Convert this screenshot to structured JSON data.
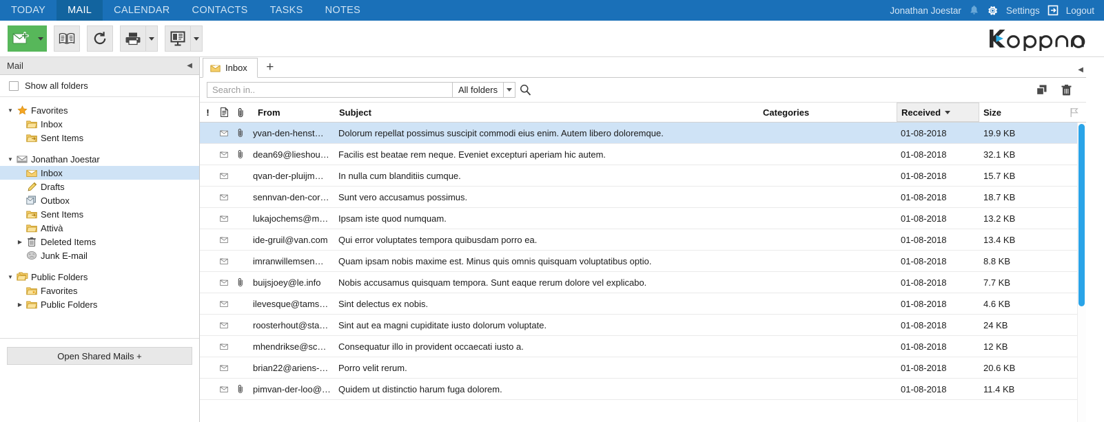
{
  "topnav": {
    "tabs": [
      {
        "label": "TODAY",
        "active": false
      },
      {
        "label": "MAIL",
        "active": true
      },
      {
        "label": "CALENDAR",
        "active": false
      },
      {
        "label": "CONTACTS",
        "active": false
      },
      {
        "label": "TASKS",
        "active": false
      },
      {
        "label": "NOTES",
        "active": false
      }
    ],
    "username": "Jonathan Joestar",
    "settings_label": "Settings",
    "logout_label": "Logout",
    "bell_icon": "bell-icon",
    "gear_icon": "gear-icon",
    "logout_icon": "logout-icon",
    "accent_color": "#1a70b8",
    "active_tab_color": "#12649f"
  },
  "toolbar": {
    "new_mail": {
      "icon": "new-mail-icon",
      "color": "#57b75a"
    },
    "address_book": {
      "icon": "address-book-icon"
    },
    "refresh": {
      "icon": "refresh-icon"
    },
    "print": {
      "icon": "print-icon"
    },
    "view": {
      "icon": "view-layout-icon"
    }
  },
  "logo": {
    "k": "K",
    "rest": "opano",
    "accent": "#29abe2"
  },
  "sidebar": {
    "header_title": "Mail",
    "collapse_icon": "collapse-left-icon",
    "show_all_label": "Show all folders",
    "show_all_checked": false,
    "tree": [
      {
        "label": "Favorites",
        "icon": "star-icon",
        "level": 0,
        "twisty": "down",
        "selected": false
      },
      {
        "label": "Inbox",
        "icon": "folder-open-icon",
        "level": 1,
        "twisty": "",
        "selected": false
      },
      {
        "label": "Sent Items",
        "icon": "folder-sent-icon",
        "level": 1,
        "twisty": "",
        "selected": false
      },
      {
        "label": "",
        "icon": "",
        "level": 0,
        "twisty": "",
        "selected": false,
        "spacer": true
      },
      {
        "label": "Jonathan Joestar",
        "icon": "mailbox-icon",
        "level": 0,
        "twisty": "down",
        "selected": false
      },
      {
        "label": "Inbox",
        "icon": "inbox-folder-icon",
        "level": 1,
        "twisty": "",
        "selected": true
      },
      {
        "label": "Drafts",
        "icon": "pencil-icon",
        "level": 1,
        "twisty": "",
        "selected": false
      },
      {
        "label": "Outbox",
        "icon": "outbox-icon",
        "level": 1,
        "twisty": "",
        "selected": false
      },
      {
        "label": "Sent Items",
        "icon": "folder-sent-icon",
        "level": 1,
        "twisty": "",
        "selected": false
      },
      {
        "label": "Attivà",
        "icon": "folder-open-icon",
        "level": 1,
        "twisty": "",
        "selected": false
      },
      {
        "label": "Deleted Items",
        "icon": "trash-icon",
        "level": 1,
        "twisty": "right",
        "selected": false
      },
      {
        "label": "Junk E-mail",
        "icon": "junk-icon",
        "level": 1,
        "twisty": "",
        "selected": false
      },
      {
        "label": "",
        "icon": "",
        "level": 0,
        "twisty": "",
        "selected": false,
        "spacer": true
      },
      {
        "label": "Public Folders",
        "icon": "public-folders-icon",
        "level": 0,
        "twisty": "down",
        "selected": false
      },
      {
        "label": "Favorites",
        "icon": "folder-fav-icon",
        "level": 1,
        "twisty": "",
        "selected": false
      },
      {
        "label": "Public Folders",
        "icon": "folder-open-icon",
        "level": 1,
        "twisty": "right",
        "selected": false
      }
    ],
    "shared_button_label": "Open Shared Mails +"
  },
  "main": {
    "tab": {
      "label": "Inbox",
      "icon": "inbox-folder-icon"
    },
    "add_tab_label": "+",
    "search": {
      "placeholder": "Search in..",
      "value": "",
      "scope_label": "All folders",
      "search_icon": "magnifier-icon",
      "caret_icon": "chevron-down-icon"
    },
    "actions": {
      "copy_icon": "copy-move-icon",
      "delete_icon": "trash-icon"
    },
    "right_collapse_icon": "collapse-right-icon",
    "columns": {
      "importance": "!",
      "note_icon": "note-icon",
      "attachment_icon": "paperclip-icon",
      "from": "From",
      "subject": "Subject",
      "categories": "Categories",
      "received": "Received",
      "size": "Size",
      "flag_icon": "flag-icon",
      "sort_column": "Received",
      "sort_direction": "desc"
    },
    "rows": [
      {
        "read": true,
        "attachment": true,
        "from": "yvan-den-henst…",
        "subject": "Dolorum repellat possimus suscipit commodi eius enim. Autem libero doloremque.",
        "categories": "",
        "received": "01-08-2018",
        "size": "19.9 KB",
        "selected": true
      },
      {
        "read": true,
        "attachment": true,
        "from": "dean69@lieshou…",
        "subject": "Facilis est beatae rem neque. Eveniet excepturi aperiam hic autem.",
        "categories": "",
        "received": "01-08-2018",
        "size": "32.1 KB",
        "selected": false
      },
      {
        "read": true,
        "attachment": false,
        "from": "qvan-der-pluijm…",
        "subject": "In nulla cum blanditiis cumque.",
        "categories": "",
        "received": "01-08-2018",
        "size": "15.7 KB",
        "selected": false
      },
      {
        "read": true,
        "attachment": false,
        "from": "sennvan-den-cor…",
        "subject": "Sunt vero accusamus possimus.",
        "categories": "",
        "received": "01-08-2018",
        "size": "18.7 KB",
        "selected": false
      },
      {
        "read": true,
        "attachment": false,
        "from": "lukajochems@m…",
        "subject": "Ipsam iste quod numquam.",
        "categories": "",
        "received": "01-08-2018",
        "size": "13.2 KB",
        "selected": false
      },
      {
        "read": true,
        "attachment": false,
        "from": "ide-gruil@van.com",
        "subject": "Qui error voluptates tempora quibusdam porro ea.",
        "categories": "",
        "received": "01-08-2018",
        "size": "13.4 KB",
        "selected": false
      },
      {
        "read": true,
        "attachment": false,
        "from": "imranwillemsen…",
        "subject": "Quam ipsam nobis maxime est. Minus quis omnis quisquam voluptatibus optio.",
        "categories": "",
        "received": "01-08-2018",
        "size": "8.8 KB",
        "selected": false
      },
      {
        "read": true,
        "attachment": true,
        "from": "buijsjoey@le.info",
        "subject": "Nobis accusamus quisquam tempora. Sunt eaque rerum dolore vel explicabo.",
        "categories": "",
        "received": "01-08-2018",
        "size": "7.7 KB",
        "selected": false
      },
      {
        "read": true,
        "attachment": false,
        "from": "ilevesque@tams…",
        "subject": "Sint delectus ex nobis.",
        "categories": "",
        "received": "01-08-2018",
        "size": "4.6 KB",
        "selected": false
      },
      {
        "read": true,
        "attachment": false,
        "from": "roosterhout@sta…",
        "subject": "Sint aut ea magni cupiditate iusto dolorum voluptate.",
        "categories": "",
        "received": "01-08-2018",
        "size": "24 KB",
        "selected": false
      },
      {
        "read": true,
        "attachment": false,
        "from": "mhendrikse@sc…",
        "subject": "Consequatur illo in provident occaecati iusto a.",
        "categories": "",
        "received": "01-08-2018",
        "size": "12 KB",
        "selected": false
      },
      {
        "read": true,
        "attachment": false,
        "from": "brian22@ariens-…",
        "subject": "Porro velit rerum.",
        "categories": "",
        "received": "01-08-2018",
        "size": "20.6 KB",
        "selected": false
      },
      {
        "read": true,
        "attachment": true,
        "from": "pimvan-der-loo@…",
        "subject": "Quidem ut distinctio harum fuga dolorem.",
        "categories": "",
        "received": "01-08-2018",
        "size": "11.4 KB",
        "selected": false
      }
    ]
  }
}
